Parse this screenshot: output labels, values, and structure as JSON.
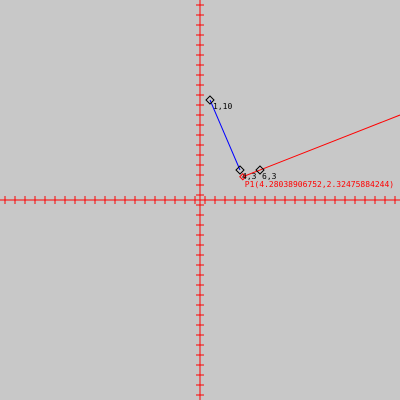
{
  "canvas": {
    "background": "#c8c8c8",
    "axis_color": "#ff0000",
    "blue_segment_color": "#0000ff",
    "ray_color": "#ff0000",
    "handle_color": "#000000"
  },
  "points": [
    {
      "name": "point-1-10",
      "label": "1,10",
      "x": 1,
      "y": 10
    },
    {
      "name": "point-4-3",
      "label": "4,3",
      "x": 4,
      "y": 3
    },
    {
      "name": "point-6-3",
      "label": "6,3",
      "x": 6,
      "y": 3
    }
  ],
  "intersection": {
    "label": "P1(4.28038906752,2.32475884244)",
    "x": 4.28038906752,
    "y": 2.32475884244
  }
}
